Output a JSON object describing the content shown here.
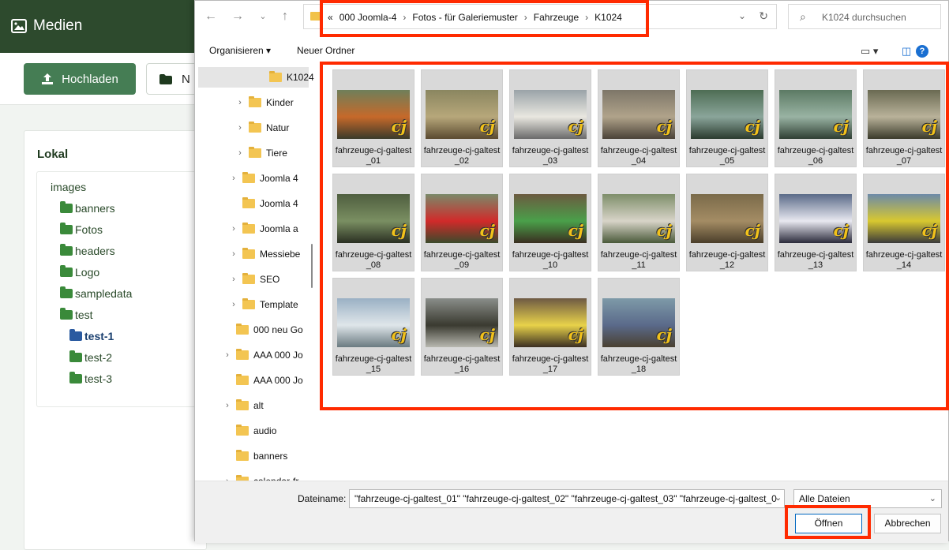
{
  "app": {
    "title": "Medien",
    "upload_label": "Hochladen",
    "new_label": "N",
    "panel_title": "Lokal",
    "tree": [
      {
        "label": "images",
        "folder": false,
        "active": false
      },
      {
        "label": "banners",
        "folder": true,
        "active": false
      },
      {
        "label": "Fotos",
        "folder": true,
        "active": false
      },
      {
        "label": "headers",
        "folder": true,
        "active": false
      },
      {
        "label": "Logo",
        "folder": true,
        "active": false
      },
      {
        "label": "sampledata",
        "folder": true,
        "active": false
      },
      {
        "label": "test",
        "folder": true,
        "active": false
      },
      {
        "label": "test-1",
        "folder": true,
        "active": true
      },
      {
        "label": "test-2",
        "folder": true,
        "active": false
      },
      {
        "label": "test-3",
        "folder": true,
        "active": false
      }
    ]
  },
  "dialog": {
    "breadcrumb_prefix": "«",
    "breadcrumb": [
      "000 Joomla-4",
      "Fotos - für Galeriemuster",
      "Fahrzeuge",
      "K1024"
    ],
    "breadcrumb_sep": "›",
    "search_placeholder": "K1024 durchsuchen",
    "toolbar": {
      "organize": "Organisieren ▾",
      "new_folder": "Neuer Ordner",
      "help": "?"
    },
    "nav_items": [
      {
        "label": "K1024",
        "chev": ""
      },
      {
        "label": "Kinder",
        "chev": "›"
      },
      {
        "label": "Natur",
        "chev": "›"
      },
      {
        "label": "Tiere",
        "chev": "›"
      },
      {
        "label": "Joomla 4",
        "chev": "›"
      },
      {
        "label": "Joomla 4",
        "chev": ""
      },
      {
        "label": "Joomla a",
        "chev": "›"
      },
      {
        "label": "Messiebe",
        "chev": "›"
      },
      {
        "label": "SEO",
        "chev": "›"
      },
      {
        "label": "Template",
        "chev": "›"
      },
      {
        "label": "000 neu Go",
        "chev": ""
      },
      {
        "label": "AAA 000 Jo",
        "chev": "›"
      },
      {
        "label": "AAA 000 Jo",
        "chev": ""
      },
      {
        "label": "alt",
        "chev": "›"
      },
      {
        "label": "audio",
        "chev": ""
      },
      {
        "label": "banners",
        "chev": ""
      },
      {
        "label": "calendar-fr",
        "chev": "›"
      }
    ],
    "files": [
      "fahrzeuge-cj-galtest_01",
      "fahrzeuge-cj-galtest_02",
      "fahrzeuge-cj-galtest_03",
      "fahrzeuge-cj-galtest_04",
      "fahrzeuge-cj-galtest_05",
      "fahrzeuge-cj-galtest_06",
      "fahrzeuge-cj-galtest_07",
      "fahrzeuge-cj-galtest_08",
      "fahrzeuge-cj-galtest_09",
      "fahrzeuge-cj-galtest_10",
      "fahrzeuge-cj-galtest_11",
      "fahrzeuge-cj-galtest_12",
      "fahrzeuge-cj-galtest_13",
      "fahrzeuge-cj-galtest_14",
      "fahrzeuge-cj-galtest_15",
      "fahrzeuge-cj-galtest_16",
      "fahrzeuge-cj-galtest_17",
      "fahrzeuge-cj-galtest_18"
    ],
    "watermark": "cj",
    "filename_label": "Dateiname:",
    "filename_value": "\"fahrzeuge-cj-galtest_01\" \"fahrzeuge-cj-galtest_02\" \"fahrzeuge-cj-galtest_03\" \"fahrzeuge-cj-galtest_0",
    "filetype": "Alle Dateien",
    "open_label": "Öffnen",
    "cancel_label": "Abbrechen"
  },
  "colors": {
    "highlight": "#ff2a00",
    "header": "#2d4a2d",
    "accent": "#457d54"
  }
}
